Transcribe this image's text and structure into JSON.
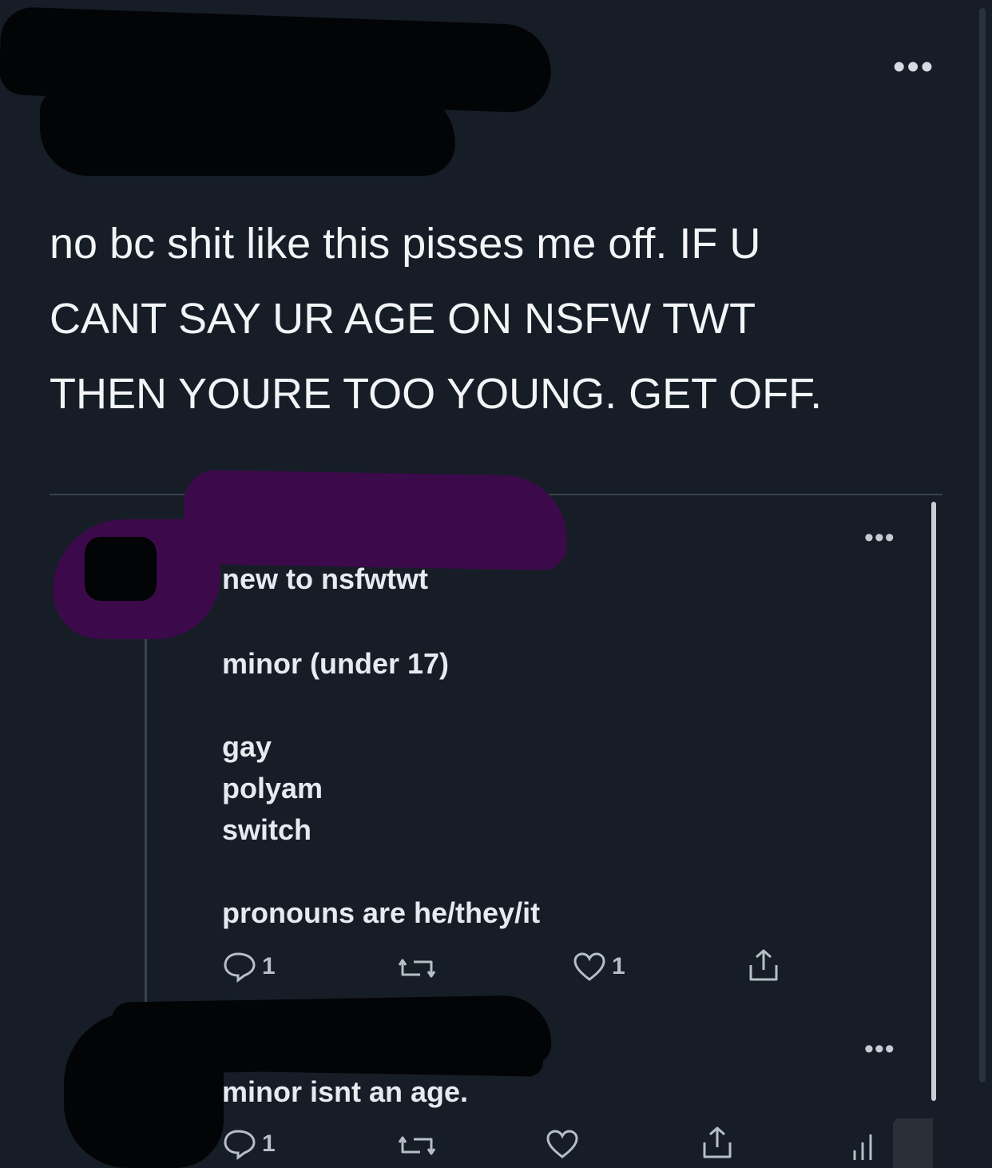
{
  "tweet": {
    "more_label": "•••",
    "text_lines": [
      "no bc shit like this pisses me off. IF U",
      "CANT SAY UR AGE ON NSFW TWT",
      "THEN YOURE TOO YOUNG. GET OFF."
    ]
  },
  "embedded": {
    "reply1": {
      "more_label": "•••",
      "lines": [
        "new to nsfwtwt",
        "minor (under 17)",
        "gay",
        "polyam",
        "switch",
        "pronouns are he/they/it"
      ],
      "reply_count": "1",
      "like_count": "1"
    },
    "reply2": {
      "more_label": "•••",
      "text": "minor isnt an age.",
      "reply_count": "1"
    }
  },
  "icons": {
    "reply": "reply-icon",
    "retweet": "retweet-icon",
    "like": "heart-icon",
    "share": "share-icon",
    "stats": "stats-icon"
  },
  "colors": {
    "background": "#161d27",
    "text": "#f2f4f6",
    "icon": "#b7bec6"
  }
}
